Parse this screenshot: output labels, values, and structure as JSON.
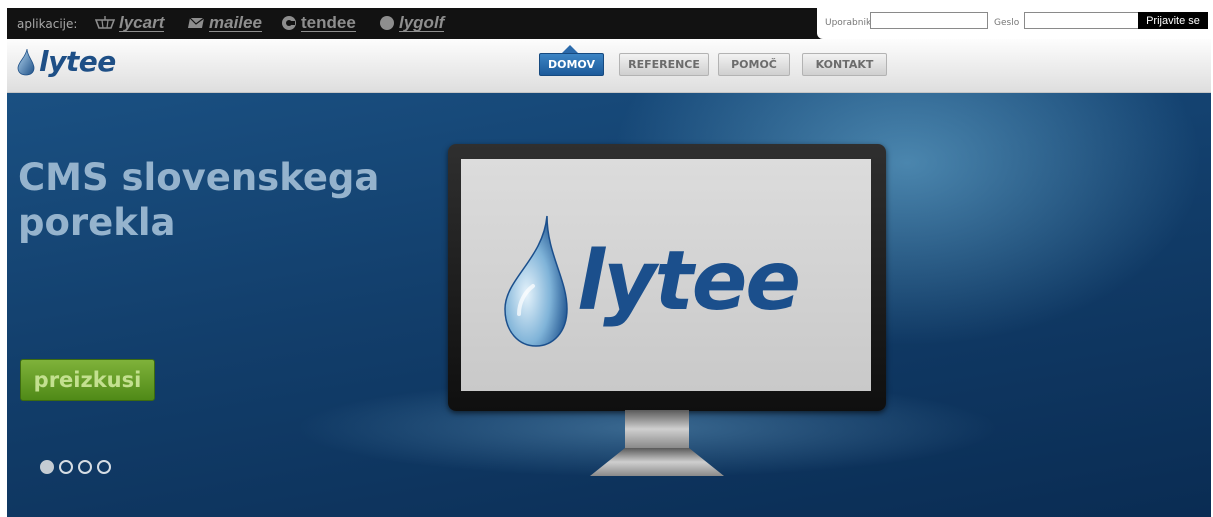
{
  "appbar": {
    "label": "aplikacije:",
    "apps": [
      {
        "name": "lycart",
        "icon": "cart-icon"
      },
      {
        "name": "mailee",
        "icon": "mail-icon"
      },
      {
        "name": "tendee",
        "icon": "tendee-icon"
      },
      {
        "name": "lygolf",
        "icon": "golf-ball-icon"
      }
    ]
  },
  "login": {
    "username_label": "Uporabnik",
    "username_value": "",
    "password_label": "Geslo",
    "password_value": "",
    "submit_label": "Prijavite se"
  },
  "header": {
    "logo_text": "lytee",
    "nav": [
      {
        "label": "DOMOV",
        "active": true
      },
      {
        "label": "REFERENCE",
        "active": false
      },
      {
        "label": "POMOČ",
        "active": false
      },
      {
        "label": "KONTAKT",
        "active": false
      }
    ]
  },
  "hero": {
    "title": "CMS slovenskega porekla",
    "cta_label": "preizkusi",
    "screen_logo_text": "lytee",
    "slides_total": 4,
    "slide_active": 1
  },
  "colors": {
    "appbar_bg": "#121212",
    "nav_active": "#1c5a9a",
    "hero_bg": "#123e6b",
    "cta_green": "#5f9a1f",
    "logo_blue": "#1e4f86"
  }
}
